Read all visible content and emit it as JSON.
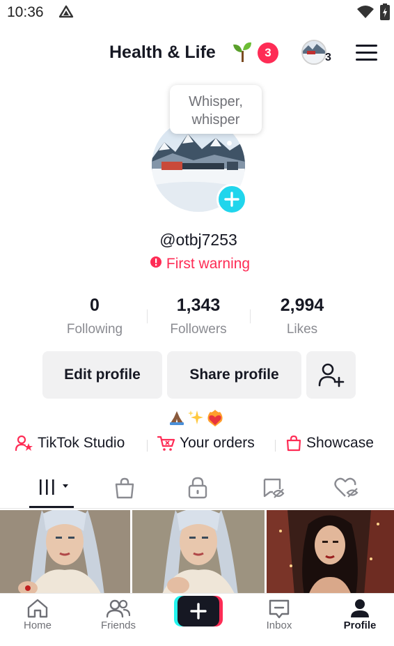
{
  "status_bar": {
    "time": "10:36",
    "left_icon": "navigation-triangle-icon",
    "right_icons": [
      "wifi-icon",
      "battery-charging-icon"
    ]
  },
  "header": {
    "title": "Health & Life",
    "title_emoji": "seedling-emoji",
    "notification_count": "3",
    "story_count": "3",
    "menu_icon": "hamburger-menu-icon"
  },
  "profile": {
    "bubble_text": "Whisper, whisper",
    "username": "@otbj7253",
    "warning": "First warning",
    "stats": [
      {
        "value": "0",
        "label": "Following"
      },
      {
        "value": "1,343",
        "label": "Followers"
      },
      {
        "value": "2,994",
        "label": "Likes"
      }
    ]
  },
  "actions": {
    "edit_profile": "Edit profile",
    "share_profile": "Share profile",
    "add_friend_icon": "add-user-icon"
  },
  "bio_emojis": [
    "folded-hands-emoji",
    "sparkles-emoji",
    "heart-on-fire-emoji"
  ],
  "tools": [
    {
      "label": "TikTok Studio",
      "icon": "person-star-icon"
    },
    {
      "label": "Your orders",
      "icon": "shopping-cart-icon"
    },
    {
      "label": "Showcase",
      "icon": "shopping-bag-icon"
    }
  ],
  "tabs": [
    {
      "icon": "videos-grid-icon",
      "selected": true
    },
    {
      "icon": "shop-bag-icon",
      "selected": false
    },
    {
      "icon": "lock-icon",
      "selected": false
    },
    {
      "icon": "reposts-hidden-icon",
      "selected": false
    },
    {
      "icon": "liked-hidden-icon",
      "selected": false
    }
  ],
  "video_thumbnails": 3,
  "bottom_nav": [
    {
      "label": "Home",
      "icon": "home-icon"
    },
    {
      "label": "Friends",
      "icon": "friends-icon"
    },
    {
      "label": "",
      "icon": "create-plus-icon"
    },
    {
      "label": "Inbox",
      "icon": "inbox-icon"
    },
    {
      "label": "Profile",
      "icon": "profile-icon",
      "active": true
    }
  ],
  "colors": {
    "accent_red": "#fe2c55",
    "accent_cyan": "#25f4ee",
    "add_story_blue": "#20d5ec",
    "text_primary": "#161823",
    "text_secondary": "#8a8b91",
    "button_bg": "#f1f1f2"
  }
}
